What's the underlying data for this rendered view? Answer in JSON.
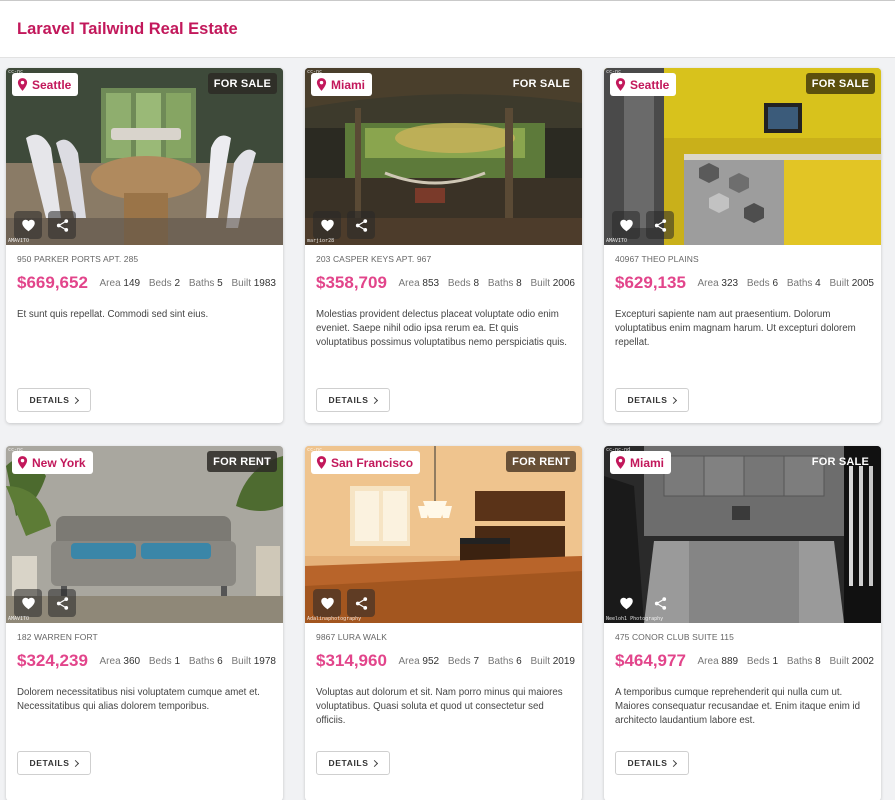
{
  "app": {
    "title": "Laravel Tailwind Real Estate"
  },
  "colors": {
    "brand": "#c2185b",
    "price": "#e2458b"
  },
  "listings": [
    {
      "city": "Seattle",
      "status": "FOR SALE",
      "address": "950 Parker Ports Apt. 285",
      "price": "$669,652",
      "area_label": "Area",
      "area": "149",
      "beds_label": "Beds",
      "beds": "2",
      "baths_label": "Baths",
      "baths": "5",
      "built_label": "Built",
      "built": "1983",
      "description": "Et sunt quis repellat. Commodi sed sint eius.",
      "details_label": "DETAILS",
      "photo_credit": "AMAVITO",
      "photo_license": "cc-nc"
    },
    {
      "city": "Miami",
      "status": "FOR SALE",
      "address": "203 Casper Keys Apt. 967",
      "price": "$358,709",
      "area_label": "Area",
      "area": "853",
      "beds_label": "Beds",
      "beds": "8",
      "baths_label": "Baths",
      "baths": "8",
      "built_label": "Built",
      "built": "2006",
      "description": "Molestias provident delectus placeat voluptate odio enim eveniet. Saepe nihil odio ipsa rerum ea. Et quis voluptatibus possimus voluptatibus nemo perspiciatis quis.",
      "details_label": "DETAILS",
      "photo_credit": "marjior28",
      "photo_license": "cc-nc"
    },
    {
      "city": "Seattle",
      "status": "FOR SALE",
      "address": "40967 Theo Plains",
      "price": "$629,135",
      "area_label": "Area",
      "area": "323",
      "beds_label": "Beds",
      "beds": "6",
      "baths_label": "Baths",
      "baths": "4",
      "built_label": "Built",
      "built": "2005",
      "description": "Excepturi sapiente nam aut praesentium. Dolorum voluptatibus enim magnam harum. Ut excepturi dolorem repellat.",
      "details_label": "DETAILS",
      "photo_credit": "AMAVITO",
      "photo_license": "cc-nc"
    },
    {
      "city": "New York",
      "status": "FOR RENT",
      "address": "182 Warren Fort",
      "price": "$324,239",
      "area_label": "Area",
      "area": "360",
      "beds_label": "Beds",
      "beds": "1",
      "baths_label": "Baths",
      "baths": "6",
      "built_label": "Built",
      "built": "1978",
      "description": "Dolorem necessitatibus nisi voluptatem cumque amet et. Necessitatibus qui alias dolorem temporibus.",
      "details_label": "DETAILS",
      "photo_credit": "AMAVITO",
      "photo_license": "cc-nc"
    },
    {
      "city": "San Francisco",
      "status": "FOR RENT",
      "address": "9867 Lura Walk",
      "price": "$314,960",
      "area_label": "Area",
      "area": "952",
      "beds_label": "Beds",
      "beds": "7",
      "baths_label": "Baths",
      "baths": "6",
      "built_label": "Built",
      "built": "2019",
      "description": "Voluptas aut dolorum et sit. Nam porro minus qui maiores voluptatibus. Quasi soluta et quod ut consectetur sed officiis.",
      "details_label": "DETAILS",
      "photo_credit": "Adalinaphotography",
      "photo_license": "cc-nc"
    },
    {
      "city": "Miami",
      "status": "FOR SALE",
      "address": "475 Conor Club Suite 115",
      "price": "$464,977",
      "area_label": "Area",
      "area": "889",
      "beds_label": "Beds",
      "beds": "1",
      "baths_label": "Baths",
      "baths": "8",
      "built_label": "Built",
      "built": "2002",
      "description": "A temporibus cumque reprehenderit qui nulla cum ut. Maiores consequatur recusandae et. Enim itaque enim id architecto laudantium labore est.",
      "details_label": "DETAILS",
      "photo_credit": "Neeloh1 Photography",
      "photo_license": "cc-nc-nd"
    }
  ]
}
